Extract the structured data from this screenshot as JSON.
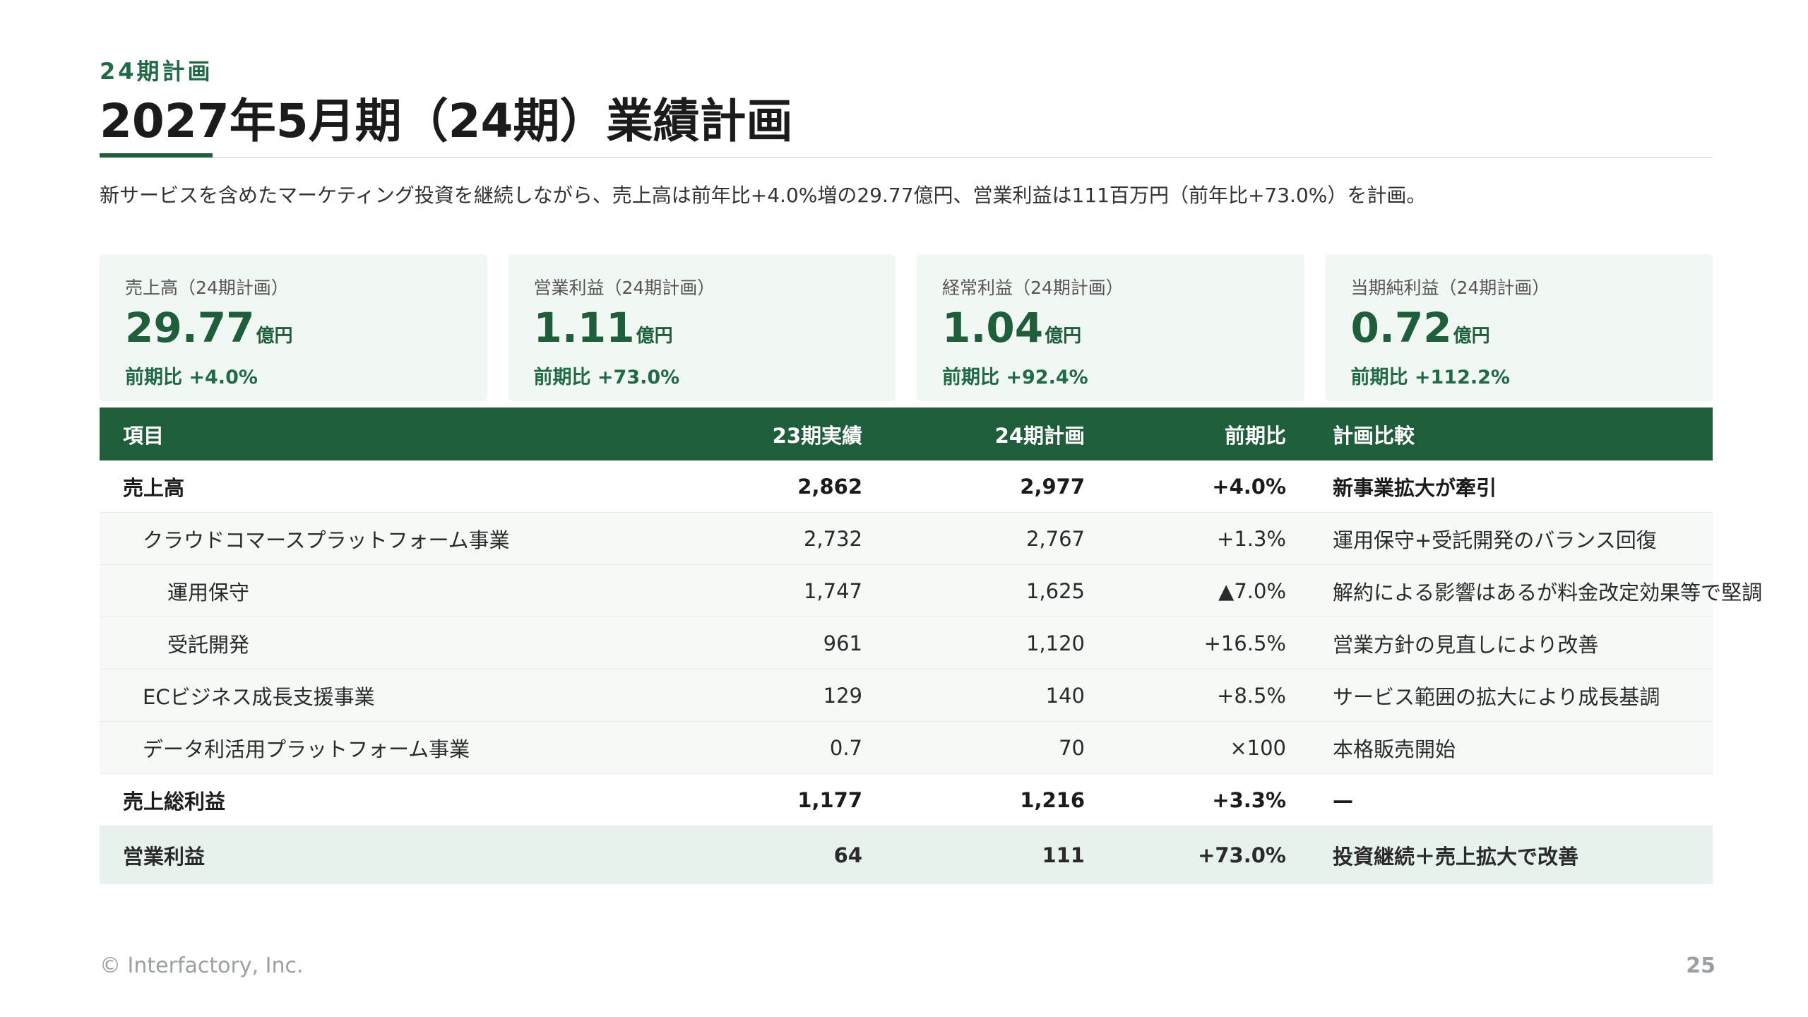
{
  "header": {
    "eyebrow": "24期計画",
    "title": "2027年5月期（24期）業績計画",
    "lead": "新サービスを含めたマーケティング投資を継続しながら、売上高は前年比+4.0%増の29.77億円、営業利益は111百万円（前年比+73.0%）を計画。"
  },
  "kpis": [
    {
      "label": "売上高（24期計画）",
      "value": "29.77",
      "unit": "億円",
      "diff": "前期比 +4.0%"
    },
    {
      "label": "営業利益（24期計画）",
      "value": "1.11",
      "unit": "億円",
      "diff": "前期比 +73.0%"
    },
    {
      "label": "経常利益（24期計画）",
      "value": "1.04",
      "unit": "億円",
      "diff": "前期比 +92.4%"
    },
    {
      "label": "当期純利益（24期計画）",
      "value": "0.72",
      "unit": "億円",
      "diff": "前期比 +112.2%"
    }
  ],
  "table": {
    "headers": {
      "item": "項目",
      "prev": "23期実績",
      "plan": "24期計画",
      "yoy": "前期比",
      "note": "計画比較"
    },
    "rows": [
      {
        "item": "売上高",
        "prev": "2,862",
        "plan": "2,977",
        "yoy": "+4.0%",
        "note": "新事業拡大が牽引"
      },
      {
        "item": "クラウドコマースプラットフォーム事業",
        "prev": "2,732",
        "plan": "2,767",
        "yoy": "+1.3%",
        "note": "運用保守+受託開発のバランス回復"
      },
      {
        "item": "運用保守",
        "prev": "1,747",
        "plan": "1,625",
        "yoy": "▲7.0%",
        "note": "解約による影響はあるが料金改定効果等で堅調"
      },
      {
        "item": "受託開発",
        "prev": "961",
        "plan": "1,120",
        "yoy": "+16.5%",
        "note": "営業方針の見直しにより改善"
      },
      {
        "item": "ECビジネス成長支援事業",
        "prev": "129",
        "plan": "140",
        "yoy": "+8.5%",
        "note": "サービス範囲の拡大により成長基調"
      },
      {
        "item": "データ利活用プラットフォーム事業",
        "prev": "0.7",
        "plan": "70",
        "yoy": "×100",
        "note": "本格販売開始"
      },
      {
        "item": "売上総利益",
        "prev": "1,177",
        "plan": "1,216",
        "yoy": "+3.3%",
        "note": "—"
      },
      {
        "item": "営業利益",
        "prev": "64",
        "plan": "111",
        "yoy": "+73.0%",
        "note": "投資継続＋売上拡大で改善"
      }
    ]
  },
  "footer": {
    "copyright": "© Interfactory, Inc.",
    "page": "25"
  },
  "colors": {
    "brand": "#1f5e3a",
    "positive": "#1f6b45",
    "negative": "#b3532f",
    "card_bg": "#f1f7f3"
  }
}
